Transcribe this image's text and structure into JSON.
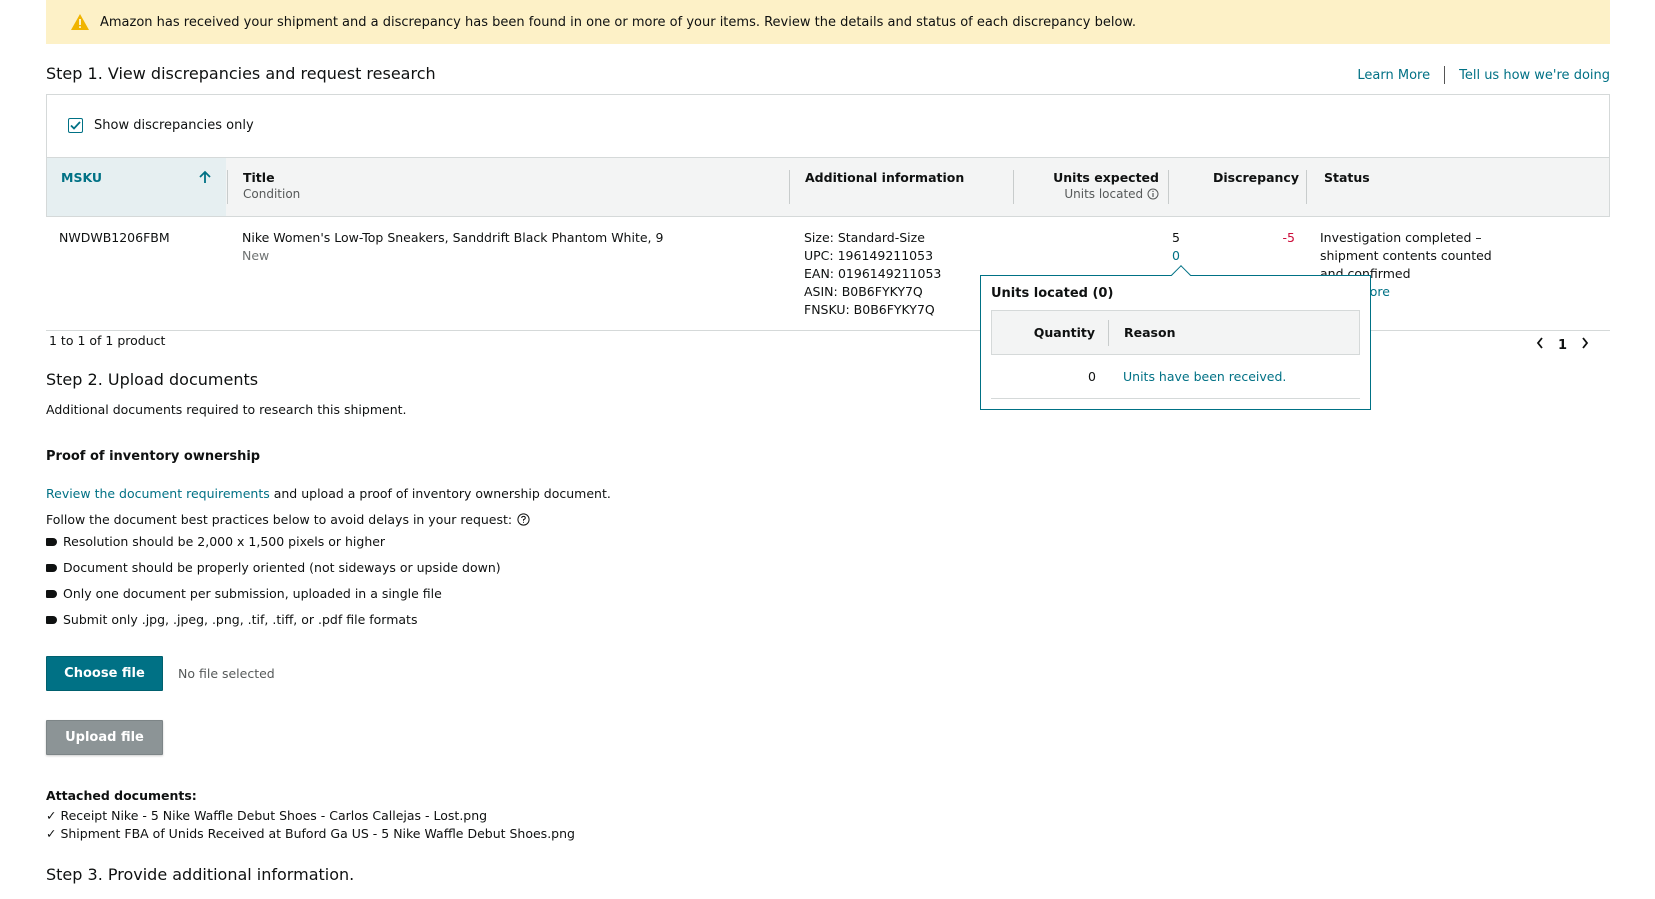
{
  "banner": {
    "text": "Amazon has received your shipment and a discrepancy has been found in one or more of your items. Review the details and status of each discrepancy below.",
    "color": "#fdf1c7"
  },
  "step1": {
    "title": "Step 1. View discrepancies and request research",
    "learn_more": "Learn More",
    "tell_us": "Tell us how we're doing",
    "show_discrepancies_label": "Show discrepancies only",
    "show_discrepancies_checked": true
  },
  "table": {
    "headers": {
      "msku": "MSKU",
      "title": "Title",
      "title_sub": "Condition",
      "additional": "Additional information",
      "units_expected": "Units expected",
      "units_located": "Units located",
      "discrepancy": "Discrepancy",
      "status": "Status"
    },
    "rows": [
      {
        "msku": "NWDWB1206FBM",
        "title": "Nike Women's Low-Top Sneakers, Sanddrift Black Phantom White, 9",
        "condition": "New",
        "size": "Size: Standard-Size",
        "upc": "UPC: 196149211053",
        "ean": "EAN: 0196149211053",
        "asin": "ASIN: B0B6FYKY7Q",
        "fnsku": "FNSKU: B0B6FYKY7Q",
        "units_expected": "5",
        "units_located": "0",
        "discrepancy": "-5",
        "status_1": "Investigation completed –",
        "status_2": "shipment contents counted",
        "status_3": "and confirmed",
        "status_link": "Learn More"
      }
    ],
    "count_text": "1 to 1 of 1 product",
    "page": "1"
  },
  "popover": {
    "title": "Units located (0)",
    "col_quantity": "Quantity",
    "col_reason": "Reason",
    "rows": [
      {
        "quantity": "0",
        "reason": "Units have been received."
      }
    ]
  },
  "step2": {
    "title": "Step 2. Upload documents",
    "subtitle": "Additional documents required to research this shipment.",
    "proof_title": "Proof of inventory ownership",
    "review_link": "Review the document requirements",
    "review_rest": " and upload a proof of inventory ownership document.",
    "follow_text": "Follow the document best practices below to avoid delays in your request:",
    "bullets": [
      "Resolution should be 2,000 x 1,500 pixels or higher",
      "Document should be properly oriented (not sideways or upside down)",
      "Only one document per submission, uploaded in a single file",
      "Submit only .jpg, .jpeg, .png, .tif, .tiff, or .pdf file formats"
    ],
    "choose_file": "Choose file",
    "no_file": "No file selected",
    "upload_file": "Upload file",
    "attached_title": "Attached documents:",
    "attached": [
      "✓ Receipt Nike - 5 Nike Waffle Debut Shoes - Carlos Callejas - Lost.png",
      "✓ Shipment FBA of Unids Received at Buford Ga US - 5 Nike Waffle Debut Shoes.png"
    ]
  },
  "step3": {
    "title": "Step 3. Provide additional information."
  },
  "colors": {
    "link": "#007185",
    "primary_button": "#007185",
    "disabled_button": "#8c9496",
    "negative": "#cc0c39",
    "warning_icon": "#f0b400"
  },
  "icons": {
    "warning": "warning-triangle-icon",
    "sort": "arrow-up-icon",
    "info": "info-circle-icon",
    "help": "question-circle-icon",
    "prev": "chevron-left-icon",
    "next": "chevron-right-icon"
  }
}
